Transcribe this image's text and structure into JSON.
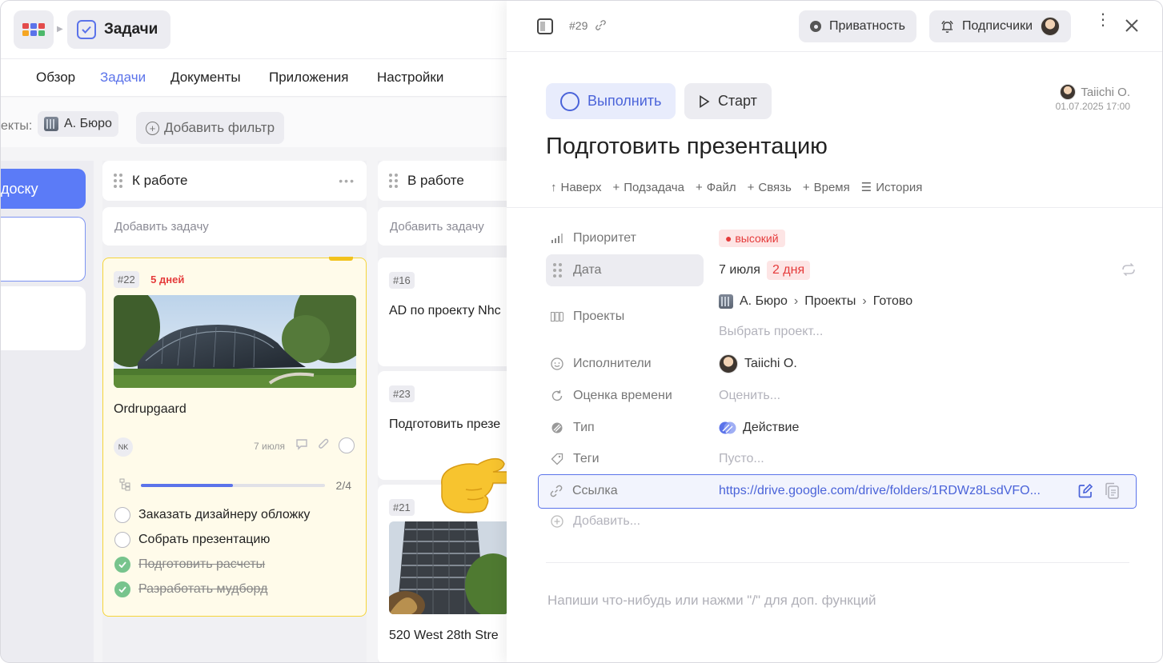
{
  "board": {
    "breadcrumb_title": "Задачи",
    "tabs": [
      {
        "label": "Обзор",
        "active": false
      },
      {
        "label": "Задачи",
        "active": true
      },
      {
        "label": "Документы",
        "active": false
      },
      {
        "label": "Приложения",
        "active": false
      },
      {
        "label": "Настройки",
        "active": false
      }
    ],
    "filter": {
      "label": "екты:",
      "chip": "А. Бюро",
      "add_label": "Добавить фильтр"
    },
    "partial_column_button": "доску",
    "columns": [
      {
        "title": "К работе",
        "add_label": "Добавить задачу",
        "cards": [
          {
            "id": "#22",
            "due_badge": "5 дней",
            "title": "Ordrupgaard",
            "assignee_initials": "NK",
            "date": "7 июля",
            "subtask_progress": "2/4",
            "subtask_fraction": 0.5,
            "checklist": [
              {
                "text": "Заказать дизайнеру обложку",
                "done": false
              },
              {
                "text": "Собрать презентацию",
                "done": false
              },
              {
                "text": "Подготовить расчеты",
                "done": true
              },
              {
                "text": "Разработать мудборд",
                "done": true
              }
            ]
          }
        ]
      },
      {
        "title": "В работе",
        "add_label": "Добавить задачу",
        "cards": [
          {
            "id": "#16",
            "title": "AD по проекту Nhc"
          },
          {
            "id": "#23",
            "title": "Подготовить презе"
          },
          {
            "id": "#21",
            "title": "520 West 28th Stre"
          }
        ]
      }
    ]
  },
  "panel": {
    "task_number": "#29",
    "privacy_label": "Приватность",
    "subscribers_label": "Подписчики",
    "complete_label": "Выполнить",
    "start_label": "Старт",
    "author_name": "Taiichi O.",
    "created_at": "01.07.2025 17:00",
    "title": "Подготовить презентацию",
    "toolbar": [
      "Наверх",
      "Подзадача",
      "Файл",
      "Связь",
      "Время",
      "История"
    ],
    "properties": {
      "priority": {
        "label": "Приоритет",
        "value": "высокий"
      },
      "date": {
        "label": "Дата",
        "value": "7 июля",
        "badge": "2 дня"
      },
      "projects": {
        "label": "Проекты",
        "path": [
          "А. Бюро",
          "Проекты",
          "Готово"
        ],
        "placeholder": "Выбрать проект..."
      },
      "assignees": {
        "label": "Исполнители",
        "value": "Taiichi O."
      },
      "estimate": {
        "label": "Оценка времени",
        "placeholder": "Оценить..."
      },
      "type": {
        "label": "Тип",
        "value": "Действие"
      },
      "tags": {
        "label": "Теги",
        "placeholder": "Пусто..."
      },
      "link": {
        "label": "Ссылка",
        "value": "https://drive.google.com/drive/folders/1RDWz8LsdVFO..."
      },
      "add": {
        "label": "Добавить..."
      }
    },
    "editor_placeholder": "Напиши что-нибудь или нажми \"/\" для доп. функций"
  },
  "colors": {
    "accent": "#5b73ea",
    "danger": "#e53b3b",
    "card_highlight": "#fffbea",
    "card_border": "#f5d53a",
    "done_green": "#77c48d"
  }
}
